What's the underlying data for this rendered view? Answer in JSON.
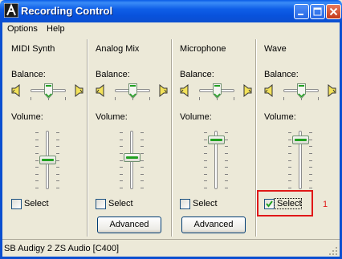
{
  "window": {
    "title": "Recording Control"
  },
  "menu": {
    "options": "Options",
    "help": "Help"
  },
  "labels": {
    "balance": "Balance:",
    "volume": "Volume:",
    "select": "Select",
    "advanced": "Advanced"
  },
  "columns": [
    {
      "name": "MIDI Synth",
      "balance": 0.5,
      "volume": 0.5,
      "selected": false,
      "advanced": false
    },
    {
      "name": "Analog Mix",
      "balance": 0.5,
      "volume": 0.55,
      "selected": false,
      "advanced": true
    },
    {
      "name": "Microphone",
      "balance": 0.5,
      "volume": 0.9,
      "selected": false,
      "advanced": true
    },
    {
      "name": "Wave",
      "balance": 0.5,
      "volume": 0.9,
      "selected": true,
      "advanced": false
    }
  ],
  "annotation": {
    "number": "1"
  },
  "status": {
    "text": "SB Audigy 2 ZS Audio [C400]"
  },
  "colors": {
    "title_bar": "#0b4fd0",
    "slider_thumb_accent": "#21a121",
    "highlight_box": "#e01818"
  }
}
